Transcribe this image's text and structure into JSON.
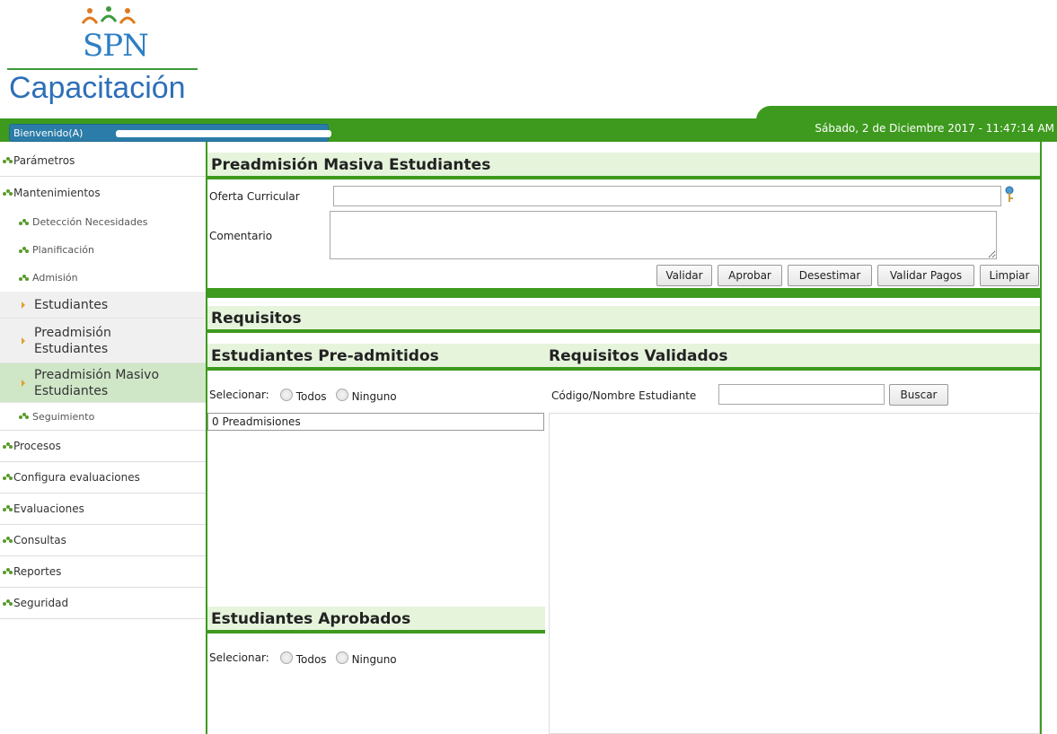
{
  "logo": {
    "brand": "SPN",
    "subtitle": "Capacitación"
  },
  "header": {
    "welcome": "Bienvenido(A)",
    "datetime": "Sábado, 2 de Diciembre 2017 - 11:47:14 AM"
  },
  "sidebar": {
    "items": [
      {
        "label": "Parámetros"
      },
      {
        "label": "Mantenimientos"
      },
      {
        "label": "Procesos"
      },
      {
        "label": "Configura evaluaciones"
      },
      {
        "label": "Evaluaciones"
      },
      {
        "label": "Consultas"
      },
      {
        "label": "Reportes"
      },
      {
        "label": "Seguridad"
      }
    ],
    "sub": [
      {
        "label": "Detección Necesidades"
      },
      {
        "label": "Planificación"
      },
      {
        "label": "Admisión"
      },
      {
        "label": "Seguimiento"
      }
    ],
    "admision_items": [
      {
        "label": "Estudiantes"
      },
      {
        "label": "Preadmisión Estudiantes"
      },
      {
        "label": "Preadmisión Masivo Estudiantes"
      }
    ]
  },
  "main": {
    "title": "Preadmisión Masiva Estudiantes",
    "oferta_label": "Oferta Curricular",
    "oferta_value": "",
    "comentario_label": "Comentario",
    "comentario_value": "",
    "buttons": {
      "validar": "Validar",
      "aprobar": "Aprobar",
      "desestimar": "Desestimar",
      "validar_pagos": "Validar Pagos",
      "limpiar": "Limpiar"
    },
    "requisitos_title": "Requisitos",
    "preadmitidos": {
      "title": "Estudiantes Pre-admitidos",
      "select_label": "Selecionar:",
      "todos": "Todos",
      "ninguno": "Ninguno",
      "count": "0 Preadmisiones"
    },
    "validados": {
      "title": "Requisitos Validados",
      "search_label": "Código/Nombre Estudiante",
      "search_value": "",
      "search_button": "Buscar"
    },
    "aprobados": {
      "title": "Estudiantes Aprobados",
      "select_label": "Selecionar:",
      "todos": "Todos",
      "ninguno": "Ninguno"
    }
  },
  "colors": {
    "green": "#3e9a1e",
    "header_bg": "#e6f4dc",
    "welcome_bg": "#2b7ca8"
  }
}
